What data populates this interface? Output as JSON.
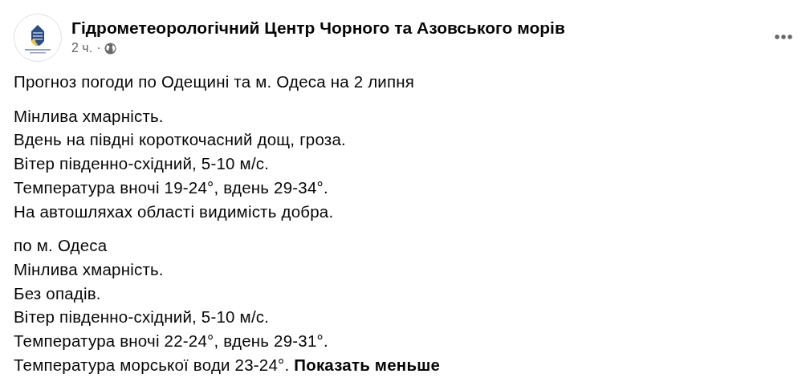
{
  "post": {
    "author": "Гідрометеорологічний Центр Чорного та Азовського морів",
    "time": "2 ч.",
    "separator": "·",
    "public": true,
    "paragraphs": [
      {
        "lines": [
          "Прогноз погоди по Одещині та м. Одеса на 2 липня"
        ]
      },
      {
        "lines": [
          "Мінлива хмарність.",
          "Вдень на півдні короткочасний дощ, гроза.",
          "Вітер південно-східний, 5-10 м/с.",
          "Температура вночі 19-24°, вдень 29-34°.",
          "На автошляхах області видимість добра."
        ]
      },
      {
        "lines": [
          "по м. Одеса",
          "Мінлива хмарність.",
          "Без опадів.",
          "Вітер південно-східний, 5-10 м/с.",
          "Температура вночі 22-24°, вдень 29-31°.",
          "Температура морської води 23-24°."
        ]
      }
    ],
    "show_less_link": "Показать меньше"
  }
}
